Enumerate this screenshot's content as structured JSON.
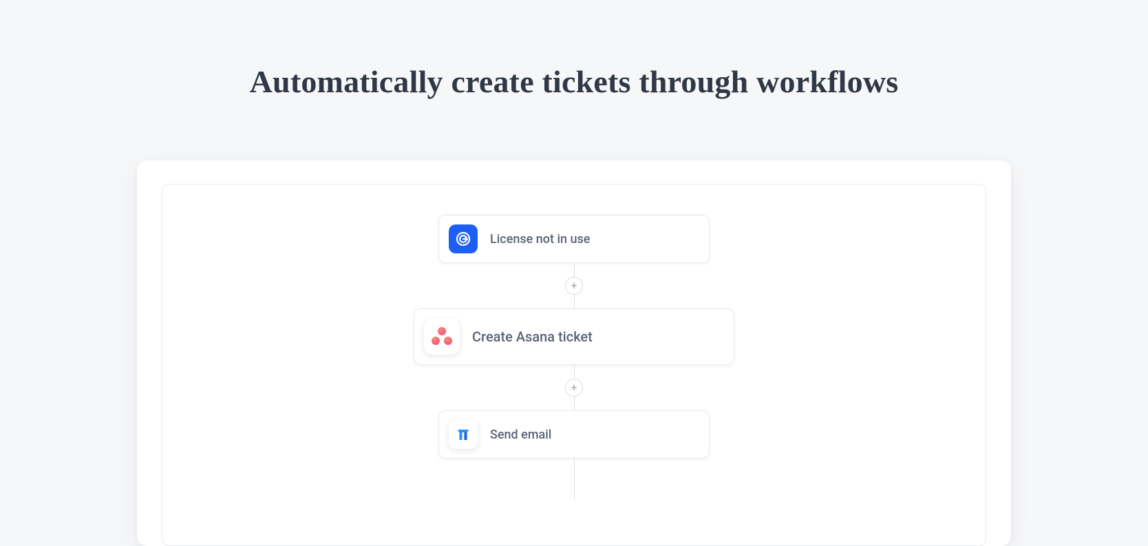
{
  "title": "Automatically create tickets through workflows",
  "workflow": {
    "trigger": {
      "label": "License not in use",
      "icon": "license-icon"
    },
    "steps": [
      {
        "label": "Create Asana ticket",
        "icon": "asana-icon"
      },
      {
        "label": "Send email",
        "icon": "torii-icon"
      }
    ],
    "add_label": "+"
  }
}
